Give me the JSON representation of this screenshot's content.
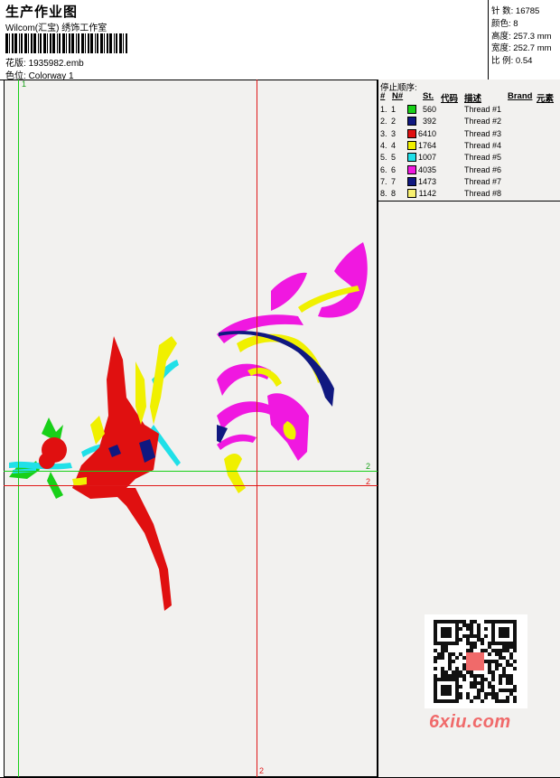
{
  "header": {
    "title": "生产作业图",
    "company": "Wilcom(汇宝) 绣饰工作室",
    "design_label": "花版:",
    "design_file": "1935982.emb",
    "colorway_label": "色位:",
    "colorway": "Colorway 1"
  },
  "stats": [
    {
      "label": "针 数:",
      "value": "16785"
    },
    {
      "label": "颜色:",
      "value": "8"
    },
    {
      "label": "高度:",
      "value": "257.3 mm"
    },
    {
      "label": "宽度:",
      "value": "252.7 mm"
    },
    {
      "label": "比 例:",
      "value": "0.54"
    }
  ],
  "guides": {
    "green_top": "1",
    "green_right": "2",
    "red_right": "2",
    "red_bottom": "2"
  },
  "thread_table": {
    "title": "停止顺序:",
    "headers": [
      "#",
      "N#",
      "St.",
      "代码",
      "描述",
      "Brand",
      "元素"
    ],
    "rows": [
      {
        "index": "1.",
        "n": "1",
        "color": "#18d018",
        "stitches": "560",
        "description": "Thread #1"
      },
      {
        "index": "2.",
        "n": "2",
        "color": "#101880",
        "stitches": "392",
        "description": "Thread #2"
      },
      {
        "index": "3.",
        "n": "3",
        "color": "#e01010",
        "stitches": "6410",
        "description": "Thread #3"
      },
      {
        "index": "4.",
        "n": "4",
        "color": "#f0f000",
        "stitches": "1764",
        "description": "Thread #4"
      },
      {
        "index": "5.",
        "n": "5",
        "color": "#20e0e8",
        "stitches": "1007",
        "description": "Thread #5"
      },
      {
        "index": "6.",
        "n": "6",
        "color": "#f018e0",
        "stitches": "4035",
        "description": "Thread #6"
      },
      {
        "index": "7.",
        "n": "7",
        "color": "#101880",
        "stitches": "1473",
        "description": "Thread #7"
      },
      {
        "index": "8.",
        "n": "8",
        "color": "#f8f070",
        "stitches": "1142",
        "description": "Thread #8"
      }
    ]
  },
  "watermark": "6xiu.com",
  "colors": {
    "red": "#e01010",
    "yellow": "#f0f000",
    "cyan": "#20e0e8",
    "magenta": "#f018e0",
    "navy": "#101880",
    "green": "#18d018"
  }
}
